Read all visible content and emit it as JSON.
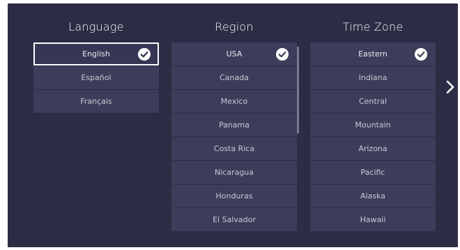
{
  "language": {
    "title": "Language",
    "items": [
      {
        "label": "English",
        "selected": true
      },
      {
        "label": "Español",
        "selected": false
      },
      {
        "label": "Français",
        "selected": false
      }
    ]
  },
  "region": {
    "title": "Region",
    "items": [
      {
        "label": "USA",
        "selected": true
      },
      {
        "label": "Canada",
        "selected": false
      },
      {
        "label": "Mexico",
        "selected": false
      },
      {
        "label": "Panama",
        "selected": false
      },
      {
        "label": "Costa Rica",
        "selected": false
      },
      {
        "label": "Nicaragua",
        "selected": false
      },
      {
        "label": "Honduras",
        "selected": false
      },
      {
        "label": "El Salvador",
        "selected": false
      }
    ]
  },
  "timezone": {
    "title": "Time Zone",
    "items": [
      {
        "label": "Eastern",
        "selected": true
      },
      {
        "label": "Indiana",
        "selected": false
      },
      {
        "label": "Central",
        "selected": false
      },
      {
        "label": "Mountain",
        "selected": false
      },
      {
        "label": "Arizona",
        "selected": false
      },
      {
        "label": "Pacific",
        "selected": false
      },
      {
        "label": "Alaska",
        "selected": false
      },
      {
        "label": "Hawaii",
        "selected": false
      }
    ]
  },
  "icons": {
    "check": "check-circle-icon",
    "next": "chevron-right-icon"
  },
  "colors": {
    "background": "#2d2c45",
    "item_background": "#3c3d5a",
    "focus_border": "#ffffff"
  }
}
